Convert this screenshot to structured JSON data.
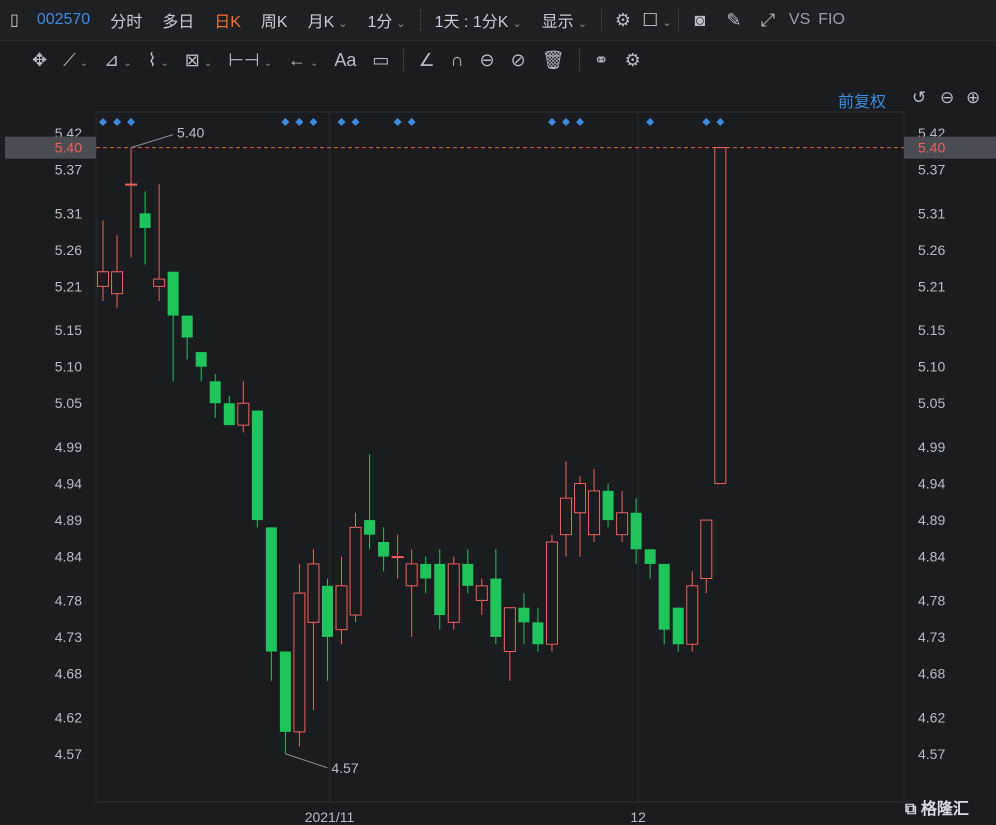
{
  "topbar": {
    "symbol": "002570",
    "tabs": [
      "分时",
      "多日",
      "日K",
      "周K",
      "月K",
      "1分"
    ],
    "active_tab": "日K",
    "range": "1天 : 1分K",
    "display": "显示",
    "compare": "VS",
    "indicator": "FIO"
  },
  "toolbar": {
    "font_label": "Aa"
  },
  "panel": {
    "adjust_label": "前复权"
  },
  "watermark": "格隆汇",
  "chart_data": {
    "type": "candlestick",
    "y_ticks": [
      "5.42",
      "5.37",
      "5.31",
      "5.26",
      "5.21",
      "5.15",
      "5.10",
      "5.05",
      "4.99",
      "4.94",
      "4.89",
      "4.84",
      "4.78",
      "4.73",
      "4.68",
      "4.62",
      "4.57"
    ],
    "ylim": [
      4.53,
      5.42
    ],
    "x_ticks": [
      {
        "label": "2021/11",
        "index": 16
      },
      {
        "label": "12",
        "index": 38
      }
    ],
    "current_price": "5.40",
    "high_annotation": {
      "label": "5.40",
      "index": 2
    },
    "low_annotation": {
      "label": "4.57",
      "index": 13
    },
    "event_marker_indices": [
      0,
      1,
      2,
      13,
      14,
      15,
      17,
      18,
      21,
      22,
      32,
      33,
      34,
      39,
      43,
      44
    ],
    "up_color": "#f0605a",
    "down_color": "#1fc45b",
    "candles": [
      {
        "o": 5.21,
        "h": 5.3,
        "l": 5.19,
        "c": 5.23
      },
      {
        "o": 5.2,
        "h": 5.28,
        "l": 5.18,
        "c": 5.23
      },
      {
        "o": 5.35,
        "h": 5.4,
        "l": 5.25,
        "c": 5.35
      },
      {
        "o": 5.31,
        "h": 5.34,
        "l": 5.24,
        "c": 5.29
      },
      {
        "o": 5.21,
        "h": 5.35,
        "l": 5.19,
        "c": 5.22
      },
      {
        "o": 5.23,
        "h": 5.23,
        "l": 5.08,
        "c": 5.17
      },
      {
        "o": 5.17,
        "h": 5.17,
        "l": 5.11,
        "c": 5.14
      },
      {
        "o": 5.12,
        "h": 5.12,
        "l": 5.08,
        "c": 5.1
      },
      {
        "o": 5.08,
        "h": 5.09,
        "l": 5.03,
        "c": 5.05
      },
      {
        "o": 5.05,
        "h": 5.06,
        "l": 5.02,
        "c": 5.02
      },
      {
        "o": 5.02,
        "h": 5.08,
        "l": 5.01,
        "c": 5.05
      },
      {
        "o": 5.04,
        "h": 5.04,
        "l": 4.88,
        "c": 4.89
      },
      {
        "o": 4.88,
        "h": 4.88,
        "l": 4.67,
        "c": 4.71
      },
      {
        "o": 4.71,
        "h": 4.71,
        "l": 4.57,
        "c": 4.6
      },
      {
        "o": 4.6,
        "h": 4.83,
        "l": 4.58,
        "c": 4.79
      },
      {
        "o": 4.75,
        "h": 4.85,
        "l": 4.63,
        "c": 4.83
      },
      {
        "o": 4.8,
        "h": 4.81,
        "l": 4.67,
        "c": 4.73
      },
      {
        "o": 4.74,
        "h": 4.84,
        "l": 4.72,
        "c": 4.8
      },
      {
        "o": 4.76,
        "h": 4.9,
        "l": 4.75,
        "c": 4.88
      },
      {
        "o": 4.89,
        "h": 4.98,
        "l": 4.85,
        "c": 4.87
      },
      {
        "o": 4.86,
        "h": 4.88,
        "l": 4.82,
        "c": 4.84
      },
      {
        "o": 4.84,
        "h": 4.87,
        "l": 4.81,
        "c": 4.84
      },
      {
        "o": 4.8,
        "h": 4.85,
        "l": 4.73,
        "c": 4.83
      },
      {
        "o": 4.83,
        "h": 4.84,
        "l": 4.79,
        "c": 4.81
      },
      {
        "o": 4.83,
        "h": 4.85,
        "l": 4.74,
        "c": 4.76
      },
      {
        "o": 4.75,
        "h": 4.84,
        "l": 4.74,
        "c": 4.83
      },
      {
        "o": 4.83,
        "h": 4.85,
        "l": 4.79,
        "c": 4.8
      },
      {
        "o": 4.78,
        "h": 4.81,
        "l": 4.76,
        "c": 4.8
      },
      {
        "o": 4.81,
        "h": 4.85,
        "l": 4.72,
        "c": 4.73
      },
      {
        "o": 4.71,
        "h": 4.77,
        "l": 4.67,
        "c": 4.77
      },
      {
        "o": 4.77,
        "h": 4.79,
        "l": 4.72,
        "c": 4.75
      },
      {
        "o": 4.75,
        "h": 4.77,
        "l": 4.71,
        "c": 4.72
      },
      {
        "o": 4.72,
        "h": 4.87,
        "l": 4.71,
        "c": 4.86
      },
      {
        "o": 4.87,
        "h": 4.97,
        "l": 4.84,
        "c": 4.92
      },
      {
        "o": 4.9,
        "h": 4.95,
        "l": 4.84,
        "c": 4.94
      },
      {
        "o": 4.87,
        "h": 4.96,
        "l": 4.86,
        "c": 4.93
      },
      {
        "o": 4.93,
        "h": 4.94,
        "l": 4.88,
        "c": 4.89
      },
      {
        "o": 4.87,
        "h": 4.93,
        "l": 4.86,
        "c": 4.9
      },
      {
        "o": 4.9,
        "h": 4.92,
        "l": 4.83,
        "c": 4.85
      },
      {
        "o": 4.85,
        "h": 4.85,
        "l": 4.81,
        "c": 4.83
      },
      {
        "o": 4.83,
        "h": 4.83,
        "l": 4.72,
        "c": 4.74
      },
      {
        "o": 4.77,
        "h": 4.77,
        "l": 4.71,
        "c": 4.72
      },
      {
        "o": 4.72,
        "h": 4.82,
        "l": 4.71,
        "c": 4.8
      },
      {
        "o": 4.81,
        "h": 4.89,
        "l": 4.79,
        "c": 4.89
      },
      {
        "o": 4.94,
        "h": 5.4,
        "l": 4.94,
        "c": 5.4
      }
    ]
  }
}
